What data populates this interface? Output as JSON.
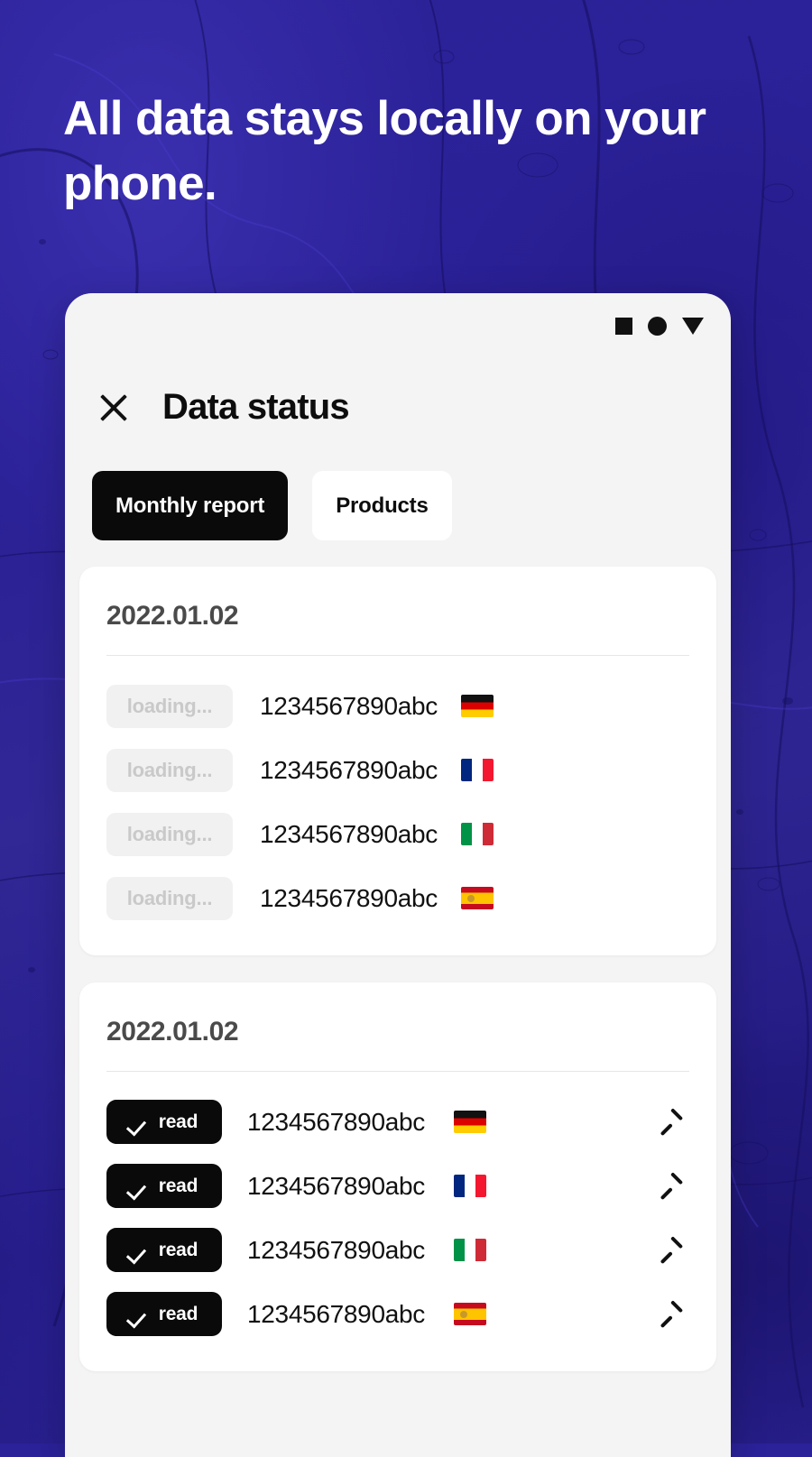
{
  "background": {
    "color": "#2b2199",
    "accent_dark": "#1d1570",
    "accent_light": "#3a2fae"
  },
  "headline": {
    "text": "All data stays locally on your phone.",
    "color": "#ffffff"
  },
  "phone": {
    "background": "#f4f4f4",
    "status_bar": {
      "icons": [
        "square-icon",
        "circle-icon",
        "triangle-down-icon"
      ],
      "color": "#111111"
    },
    "header": {
      "close_icon": "close-icon",
      "title": "Data status"
    },
    "tabs": [
      {
        "label": "Monthly report",
        "active": true,
        "bg": "#0a0a0a",
        "fg": "#ffffff"
      },
      {
        "label": "Products",
        "active": false,
        "bg": "#ffffff",
        "fg": "#0d0d0d"
      }
    ],
    "cards": [
      {
        "date": "2022.01.02",
        "rows": [
          {
            "status": "loading...",
            "status_type": "loading",
            "code": "1234567890abc",
            "flag": "de",
            "chevron": false
          },
          {
            "status": "loading...",
            "status_type": "loading",
            "code": "1234567890abc",
            "flag": "fr",
            "chevron": false
          },
          {
            "status": "loading...",
            "status_type": "loading",
            "code": "1234567890abc",
            "flag": "it",
            "chevron": false
          },
          {
            "status": "loading...",
            "status_type": "loading",
            "code": "1234567890abc",
            "flag": "es",
            "chevron": false
          }
        ]
      },
      {
        "date": "2022.01.02",
        "rows": [
          {
            "status": "read",
            "status_type": "read",
            "code": "1234567890abc",
            "flag": "de",
            "chevron": true
          },
          {
            "status": "read",
            "status_type": "read",
            "code": "1234567890abc",
            "flag": "fr",
            "chevron": true
          },
          {
            "status": "read",
            "status_type": "read",
            "code": "1234567890abc",
            "flag": "it",
            "chevron": true
          },
          {
            "status": "read",
            "status_type": "read",
            "code": "1234567890abc",
            "flag": "es",
            "chevron": true
          }
        ]
      }
    ],
    "colors": {
      "pill_loading_bg": "#f1f1f1",
      "pill_loading_fg": "#c9c9c9",
      "pill_read_bg": "#0a0a0a",
      "pill_read_fg": "#ffffff",
      "card_bg": "#ffffff",
      "date_fg": "#4a4a4a",
      "code_fg": "#111111",
      "separator": "#e6e6e6"
    }
  }
}
